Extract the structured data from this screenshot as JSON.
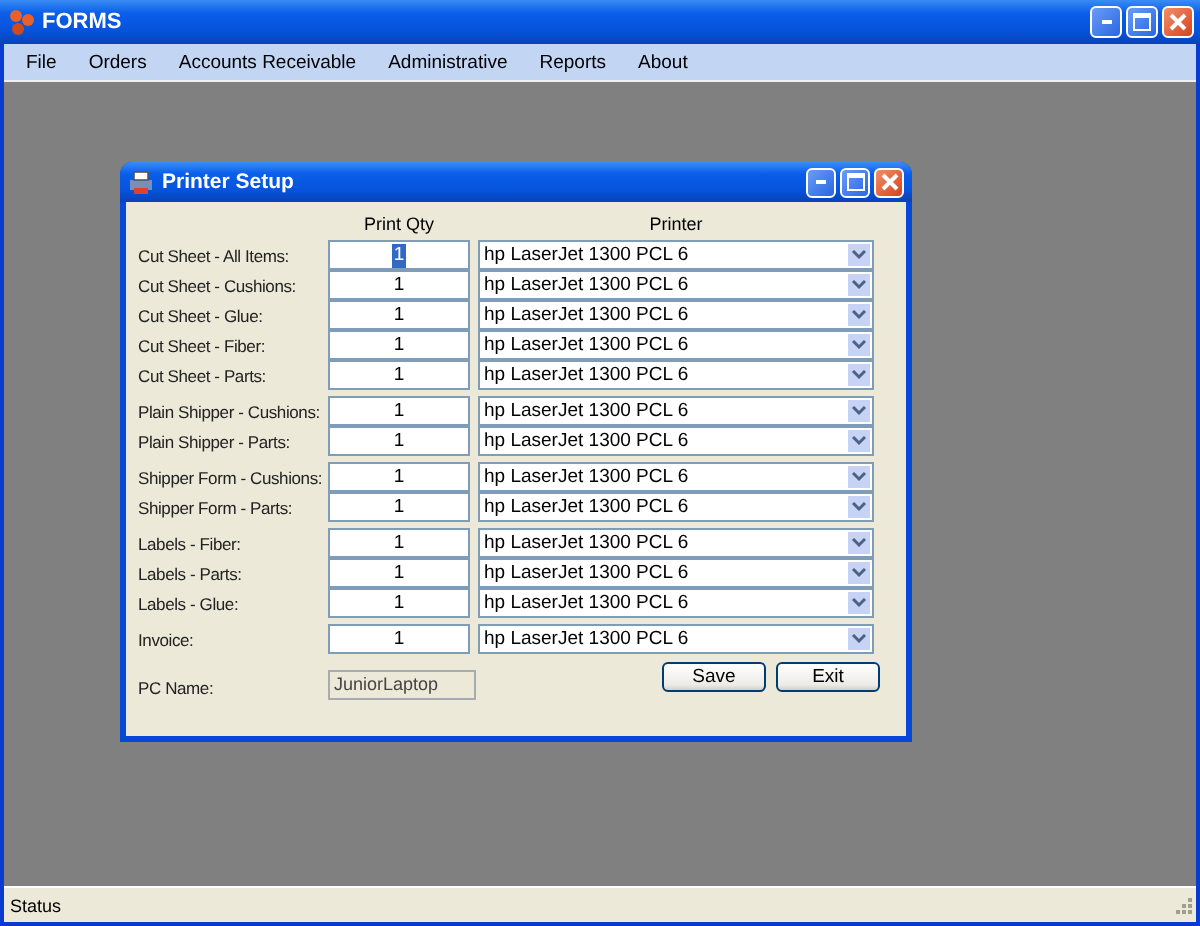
{
  "window": {
    "title": "FORMS"
  },
  "menu": [
    "File",
    "Orders",
    "Accounts Receivable",
    "Administrative",
    "Reports",
    "About"
  ],
  "dialog": {
    "title": "Printer Setup",
    "columns": [
      "Print Qty",
      "Printer"
    ],
    "groups": [
      {
        "rows": [
          {
            "label": "Cut Sheet - All Items:",
            "qty": "1",
            "qty_selected": true,
            "printer": "hp LaserJet 1300 PCL 6"
          },
          {
            "label": "Cut Sheet - Cushions:",
            "qty": "1",
            "qty_selected": false,
            "printer": "hp LaserJet 1300 PCL 6"
          },
          {
            "label": "Cut Sheet - Glue:",
            "qty": "1",
            "qty_selected": false,
            "printer": "hp LaserJet 1300 PCL 6"
          },
          {
            "label": "Cut Sheet - Fiber:",
            "qty": "1",
            "qty_selected": false,
            "printer": "hp LaserJet 1300 PCL 6"
          },
          {
            "label": "Cut Sheet - Parts:",
            "qty": "1",
            "qty_selected": false,
            "printer": "hp LaserJet 1300 PCL 6"
          }
        ]
      },
      {
        "rows": [
          {
            "label": "Plain Shipper - Cushions:",
            "qty": "1",
            "qty_selected": false,
            "printer": "hp LaserJet 1300 PCL 6"
          },
          {
            "label": "Plain Shipper - Parts:",
            "qty": "1",
            "qty_selected": false,
            "printer": "hp LaserJet 1300 PCL 6"
          }
        ]
      },
      {
        "rows": [
          {
            "label": "Shipper Form - Cushions:",
            "qty": "1",
            "qty_selected": false,
            "printer": "hp LaserJet 1300 PCL 6"
          },
          {
            "label": "Shipper Form - Parts:",
            "qty": "1",
            "qty_selected": false,
            "printer": "hp LaserJet 1300 PCL 6"
          }
        ]
      },
      {
        "rows": [
          {
            "label": "Labels - Fiber:",
            "qty": "1",
            "qty_selected": false,
            "printer": "hp LaserJet 1300 PCL 6"
          },
          {
            "label": "Labels - Parts:",
            "qty": "1",
            "qty_selected": false,
            "printer": "hp LaserJet 1300 PCL 6"
          },
          {
            "label": "Labels - Glue:",
            "qty": "1",
            "qty_selected": false,
            "printer": "hp LaserJet 1300 PCL 6"
          }
        ]
      },
      {
        "rows": [
          {
            "label": "Invoice:",
            "qty": "1",
            "qty_selected": false,
            "printer": "hp LaserJet 1300 PCL 6"
          }
        ]
      }
    ],
    "pc_name": {
      "label": "PC Name:",
      "value": "JuniorLaptop",
      "disabled": true
    },
    "buttons": [
      "Save",
      "Exit"
    ]
  },
  "status_bar": "Status"
}
